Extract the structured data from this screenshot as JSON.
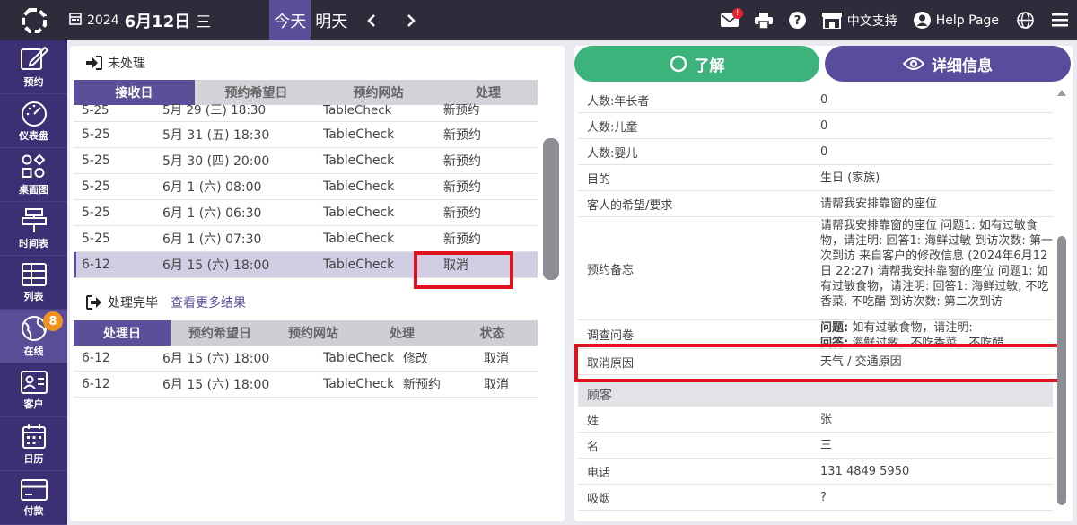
{
  "header": {
    "year": "2024",
    "month_day": "6月12日",
    "weekday": "三",
    "today_label": "今天",
    "tomorrow_label": "明天",
    "language_label": "中文支持",
    "help_label": "Help Page",
    "mail_badge": "!"
  },
  "sidebar": {
    "items": [
      {
        "label": "预约",
        "icon": "edit-icon"
      },
      {
        "label": "仪表盘",
        "icon": "dashboard-icon"
      },
      {
        "label": "桌面图",
        "icon": "table-map-icon"
      },
      {
        "label": "时间表",
        "icon": "timeline-icon"
      },
      {
        "label": "列表",
        "icon": "list-icon"
      },
      {
        "label": "在线",
        "icon": "globe-icon",
        "badge": "8"
      },
      {
        "label": "客户",
        "icon": "customer-icon"
      },
      {
        "label": "日历",
        "icon": "calendar-icon"
      },
      {
        "label": "付款",
        "icon": "payment-icon"
      }
    ]
  },
  "pending": {
    "title": "未处理",
    "columns": [
      "接收日",
      "预约希望日",
      "预约网站",
      "处理"
    ],
    "rows": [
      {
        "received": "5-25",
        "desired": "5月 29 (三) 18:30",
        "site": "TableCheck",
        "action": "新预约"
      },
      {
        "received": "5-25",
        "desired": "5月 31 (五) 18:30",
        "site": "TableCheck",
        "action": "新预约"
      },
      {
        "received": "5-25",
        "desired": "5月 30 (四) 20:00",
        "site": "TableCheck",
        "action": "新预约"
      },
      {
        "received": "5-25",
        "desired": "6月 1 (六) 08:00",
        "site": "TableCheck",
        "action": "新预约"
      },
      {
        "received": "5-25",
        "desired": "6月 1 (六) 06:30",
        "site": "TableCheck",
        "action": "新预约"
      },
      {
        "received": "5-25",
        "desired": "6月 1 (六) 07:30",
        "site": "TableCheck",
        "action": "新预约"
      },
      {
        "received": "6-12",
        "desired": "6月 15 (六) 18:00",
        "site": "TableCheck",
        "action": "取消"
      }
    ]
  },
  "done": {
    "title": "处理完毕",
    "more_link": "查看更多结果",
    "columns": [
      "处理日",
      "预约希望日",
      "预约网站",
      "处理",
      "状态"
    ],
    "rows": [
      {
        "date": "6-12",
        "desired": "6月 15 (六) 18:00",
        "site": "TableCheck",
        "action": "修改",
        "status": "取消"
      },
      {
        "date": "6-12",
        "desired": "6月 15 (六) 18:00",
        "site": "TableCheck",
        "action": "新预约",
        "status": "取消"
      }
    ]
  },
  "actions": {
    "ok_label": "了解",
    "detail_label": "详细信息"
  },
  "detail": {
    "rows": [
      {
        "k": "人数:年长者",
        "v": "0"
      },
      {
        "k": "人数:儿童",
        "v": "0"
      },
      {
        "k": "人数:婴儿",
        "v": "0"
      },
      {
        "k": "目的",
        "v": "生日 (家族)"
      },
      {
        "k": "客人的希望/要求",
        "v": "请帮我安排靠窗的座位"
      }
    ],
    "memo_label": "预约备忘",
    "memo_text": "请帮我安排靠窗的座位 问题1: 如有过敏食物，请注明:  回答1: 海鲜过敏 到访次数: 第一次到访 来自客户的修改信息 (2024年6月12日 22:27) 请帮我安排靠窗的座位 问题1: 如有过敏食物，请注明:  回答1: 海鲜过敏, 不吃香菜, 不吃醋 到访次数: 第二次到访",
    "survey_label": "调查问卷",
    "survey_q_label": "问题:",
    "survey_q": "如有过敏食物，请注明:",
    "survey_a_label": "回答:",
    "survey_a": "海鲜过敏，不吃香菜，不吃醋",
    "cancel_reason_label": "取消原因",
    "cancel_reason": "天气 / 交通原因",
    "customer_header": "顾客",
    "customer_rows": [
      {
        "k": "姓",
        "v": "张"
      },
      {
        "k": "名",
        "v": "三"
      },
      {
        "k": "电话",
        "v": "131 4849 5950"
      },
      {
        "k": "吸烟",
        "v": "?"
      }
    ]
  }
}
